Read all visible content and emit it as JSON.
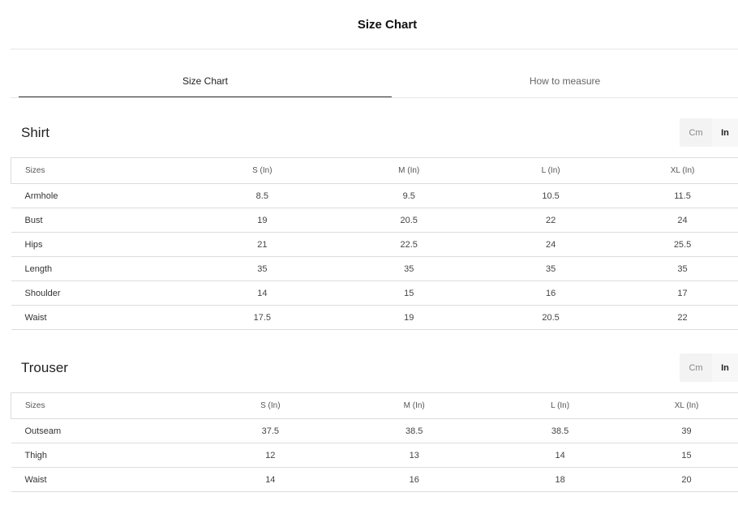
{
  "header": {
    "title": "Size Chart"
  },
  "tabs": [
    {
      "label": "Size Chart",
      "active": true
    },
    {
      "label": "How to measure",
      "active": false
    }
  ],
  "shirt": {
    "title": "Shirt",
    "units": {
      "cm": "Cm",
      "in": "In",
      "selected": "In"
    },
    "columns": [
      "Sizes",
      "S (In)",
      "M (In)",
      "L (In)",
      "XL (In)"
    ],
    "rows": [
      [
        "Armhole",
        "8.5",
        "9.5",
        "10.5",
        "11.5"
      ],
      [
        "Bust",
        "19",
        "20.5",
        "22",
        "24"
      ],
      [
        "Hips",
        "21",
        "22.5",
        "24",
        "25.5"
      ],
      [
        "Length",
        "35",
        "35",
        "35",
        "35"
      ],
      [
        "Shoulder",
        "14",
        "15",
        "16",
        "17"
      ],
      [
        "Waist",
        "17.5",
        "19",
        "20.5",
        "22"
      ]
    ]
  },
  "trouser": {
    "title": "Trouser",
    "units": {
      "cm": "Cm",
      "in": "In",
      "selected": "In"
    },
    "columns": [
      "Sizes",
      "S (In)",
      "M (In)",
      "L (In)",
      "XL (In)"
    ],
    "rows": [
      [
        "Outseam",
        "37.5",
        "38.5",
        "38.5",
        "39"
      ],
      [
        "Thigh",
        "12",
        "13",
        "14",
        "15"
      ],
      [
        "Waist",
        "14",
        "16",
        "18",
        "20"
      ]
    ]
  }
}
